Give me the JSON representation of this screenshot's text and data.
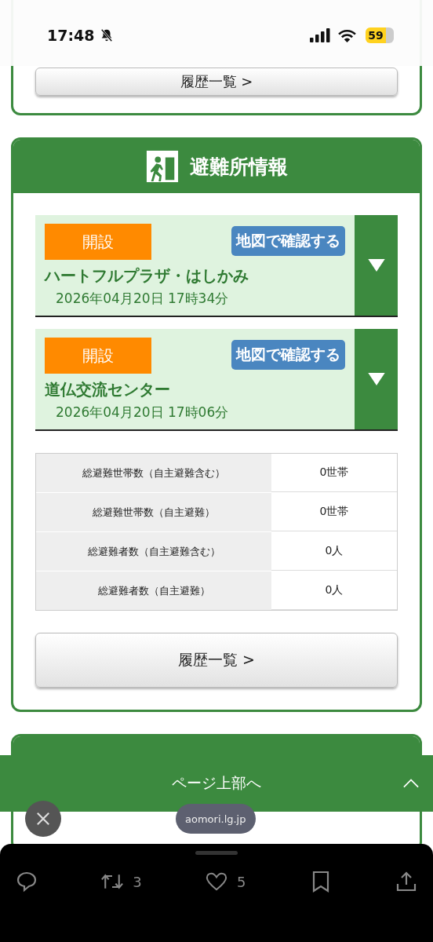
{
  "status_bar": {
    "time": "17:48",
    "battery": "59"
  },
  "top_card": {
    "history_button": "履歴一覧 >"
  },
  "shelter_section": {
    "title": "避難所情報",
    "shelters": [
      {
        "status": "開設",
        "map_button": "地図で確認する",
        "name": "ハートフルプラザ・はしかみ",
        "datetime": "2026年04月20日 17時34分",
        "expanded": false
      },
      {
        "status": "開設",
        "map_button": "地図で確認する",
        "name": "道仏交流センター",
        "datetime": "2026年04月20日 17時06分",
        "expanded": false
      }
    ],
    "stats": [
      {
        "label": "総避難世帯数（自主避難含む）",
        "value": "0世帯"
      },
      {
        "label": "総避難世帯数（自主避難）",
        "value": "0世帯"
      },
      {
        "label": "総避難者数（自主避難含む）",
        "value": "0人"
      },
      {
        "label": "総避難者数（自主避難）",
        "value": "0人"
      }
    ],
    "history_button": "履歴一覧 >"
  },
  "page_top_bar": {
    "label": "ページ上部へ"
  },
  "url_pill": "aomori.lg.jp",
  "toolbar": {
    "retweets": "3",
    "likes": "5"
  }
}
